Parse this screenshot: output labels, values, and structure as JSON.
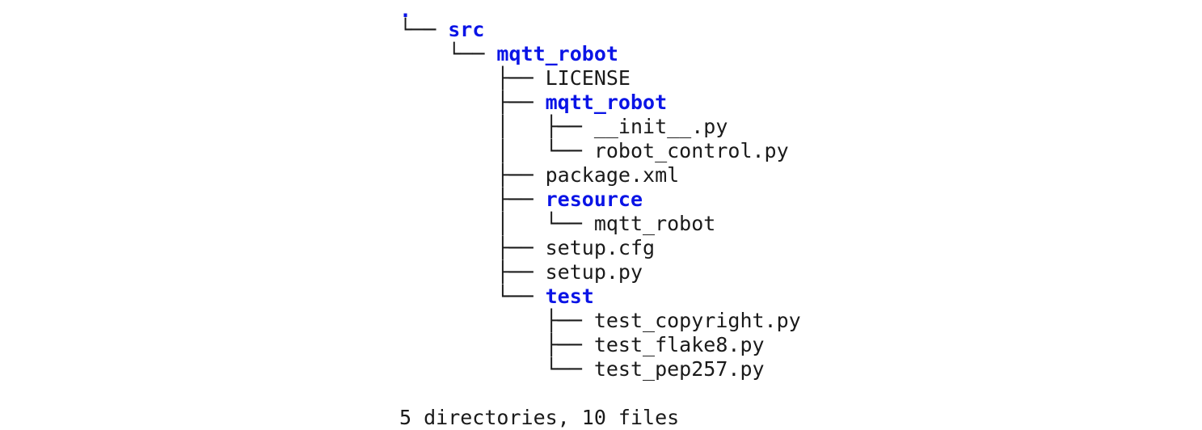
{
  "tree": {
    "root": ".",
    "lines": [
      {
        "prefix": "└── ",
        "name": "src",
        "type": "dir"
      },
      {
        "prefix": "    └── ",
        "name": "mqtt_robot",
        "type": "dir"
      },
      {
        "prefix": "        ├── ",
        "name": "LICENSE",
        "type": "file"
      },
      {
        "prefix": "        ├── ",
        "name": "mqtt_robot",
        "type": "dir"
      },
      {
        "prefix": "        │   ├── ",
        "name": "__init__.py",
        "type": "file"
      },
      {
        "prefix": "        │   └── ",
        "name": "robot_control.py",
        "type": "file"
      },
      {
        "prefix": "        ├── ",
        "name": "package.xml",
        "type": "file"
      },
      {
        "prefix": "        ├── ",
        "name": "resource",
        "type": "dir"
      },
      {
        "prefix": "        │   └── ",
        "name": "mqtt_robot",
        "type": "file"
      },
      {
        "prefix": "        ├── ",
        "name": "setup.cfg",
        "type": "file"
      },
      {
        "prefix": "        ├── ",
        "name": "setup.py",
        "type": "file"
      },
      {
        "prefix": "        └── ",
        "name": "test",
        "type": "dir"
      },
      {
        "prefix": "            ├── ",
        "name": "test_copyright.py",
        "type": "file"
      },
      {
        "prefix": "            ├── ",
        "name": "test_flake8.py",
        "type": "file"
      },
      {
        "prefix": "            └── ",
        "name": "test_pep257.py",
        "type": "file"
      }
    ],
    "summary": "5 directories, 10 files"
  },
  "colors": {
    "directory": "#0a14e6",
    "file": "#1a1a1a",
    "background": "#ffffff"
  }
}
